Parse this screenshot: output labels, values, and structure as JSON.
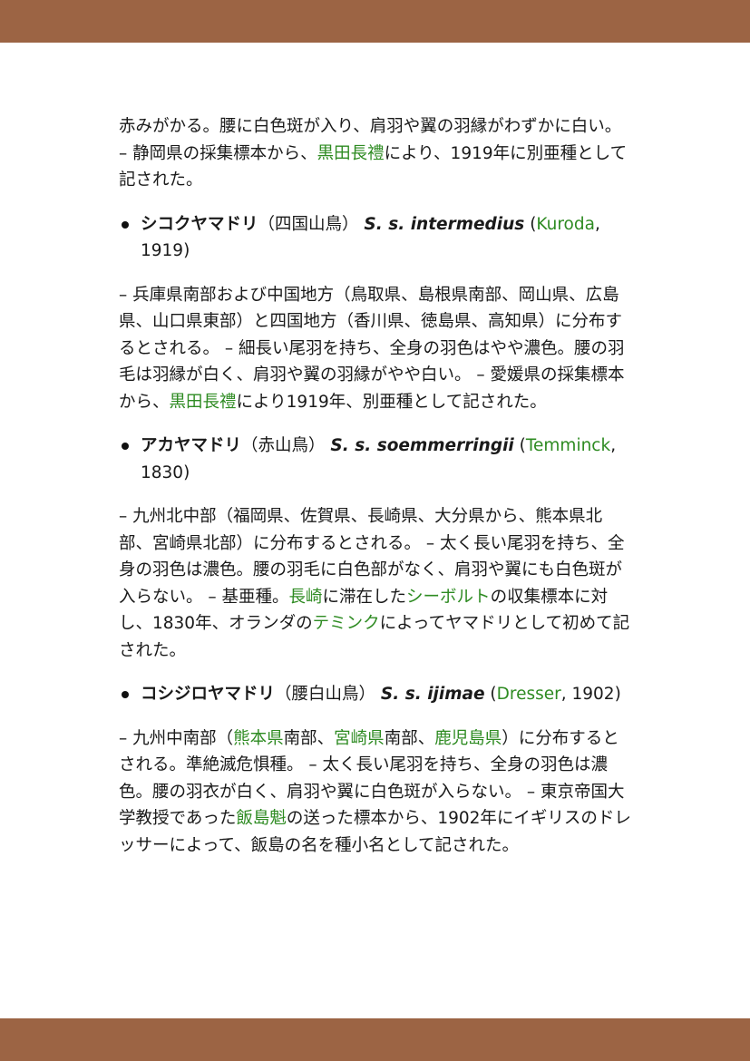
{
  "colors": {
    "band": "#9c6444",
    "link": "#2e8b22"
  },
  "intro": {
    "t1": "赤みがかる。腰に白色斑が入り、肩羽や翼の羽縁がわずかに白い。 – 静岡県の採集標本から、",
    "link1": "黒田長禮",
    "t2": "により、1919年に別亜種として記された。"
  },
  "species": [
    {
      "name": "シコクヤマドリ",
      "kanji": "（四国山鳥）",
      "sci": "S. s. intermedius",
      "author": "Kuroda",
      "year": ", 1919)",
      "desc": {
        "t1": "– 兵庫県南部および中国地方（鳥取県、島根県南部、岡山県、広島県、山口県東部）と四国地方（香川県、徳島県、高知県）に分布するとされる。 – 細長い尾羽を持ち、全身の羽色はやや濃色。腰の羽毛は羽縁が白く、肩羽や翼の羽縁がやや白い。 – 愛媛県の採集標本から、",
        "link1": "黒田長禮",
        "t2": "により1919年、別亜種として記された。"
      }
    },
    {
      "name": "アカヤマドリ",
      "kanji": "（赤山鳥）",
      "sci": "S. s. soemmerringii",
      "author": "Temminck",
      "year": ", 1830)",
      "desc": {
        "t1": "– 九州北中部（福岡県、佐賀県、長崎県、大分県から、熊本県北部、宮崎県北部）に分布するとされる。 – 太く長い尾羽を持ち、全身の羽色は濃色。腰の羽毛に白色部がなく、肩羽や翼にも白色斑が入らない。 – 基亜種。",
        "link1": "長崎",
        "t2": "に滞在した",
        "link2": "シーボルト",
        "t3": "の収集標本に対し、1830年、オランダの",
        "link3": "テミンク",
        "t4": "によってヤマドリとして初めて記された。"
      }
    },
    {
      "name": "コシジロヤマドリ",
      "kanji": "（腰白山鳥）",
      "sci": "S. s. ijimae",
      "author": "Dresser",
      "year": ", 1902)",
      "desc": {
        "t1": "– 九州中南部（",
        "link1": "熊本県",
        "t2": "南部、",
        "link2": "宮崎県",
        "t3": "南部、",
        "link3": "鹿児島県",
        "t4": "）に分布するとされる。準絶滅危惧種。 – 太く長い尾羽を持ち、全身の羽色は濃色。腰の羽衣が白く、肩羽や翼に白色斑が入らない。 – 東京帝国大学教授であった",
        "link4": "飯島魁",
        "t5": "の送った標本から、1902年にイギリスのドレッサーによって、飯島の名を種小名として記された。"
      }
    }
  ]
}
